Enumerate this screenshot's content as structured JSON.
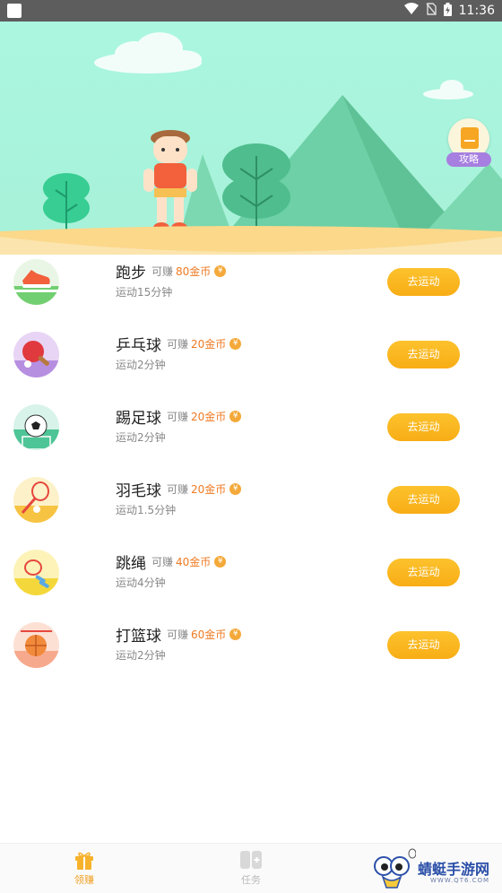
{
  "status_bar": {
    "time": "11:36",
    "icons": [
      "notification-square-icon",
      "wifi-icon",
      "no-sim-icon",
      "battery-charging-icon"
    ]
  },
  "hero": {
    "guide_label": "攻略",
    "guide_icon": "book-icon"
  },
  "colors": {
    "sky": "#abf6df",
    "mountain": "#6dd0a6",
    "ground": "#fbe4ad",
    "button": "#f8ad15",
    "amount": "#f07a22",
    "badge": "#a77fe0"
  },
  "activities": [
    {
      "name": "跑步",
      "earn_prefix": "可赚",
      "amount": "80金币",
      "coin": "¥",
      "duration": "运动15分钟",
      "button": "去运动",
      "icon": "running-shoe-icon"
    },
    {
      "name": "乒乓球",
      "earn_prefix": "可赚",
      "amount": "20金币",
      "coin": "¥",
      "duration": "运动2分钟",
      "button": "去运动",
      "icon": "ping-pong-icon"
    },
    {
      "name": "踢足球",
      "earn_prefix": "可赚",
      "amount": "20金币",
      "coin": "¥",
      "duration": "运动2分钟",
      "button": "去运动",
      "icon": "soccer-ball-icon"
    },
    {
      "name": "羽毛球",
      "earn_prefix": "可赚",
      "amount": "20金币",
      "coin": "¥",
      "duration": "运动1.5分钟",
      "button": "去运动",
      "icon": "badminton-icon"
    },
    {
      "name": "跳绳",
      "earn_prefix": "可赚",
      "amount": "40金币",
      "coin": "¥",
      "duration": "运动4分钟",
      "button": "去运动",
      "icon": "jump-rope-icon"
    },
    {
      "name": "打篮球",
      "earn_prefix": "可赚",
      "amount": "60金币",
      "coin": "¥",
      "duration": "运动2分钟",
      "button": "去运动",
      "icon": "basketball-icon"
    }
  ],
  "bottom_nav": {
    "tabs": [
      {
        "label": "领赚",
        "icon": "gift-icon",
        "active": true
      },
      {
        "label": "任务",
        "icon": "task-icon",
        "active": false
      }
    ]
  },
  "watermark": {
    "title": "蜻蜓手游网",
    "url": "WWW.QT6.COM",
    "logo": "dragonfly-mascot-icon"
  }
}
